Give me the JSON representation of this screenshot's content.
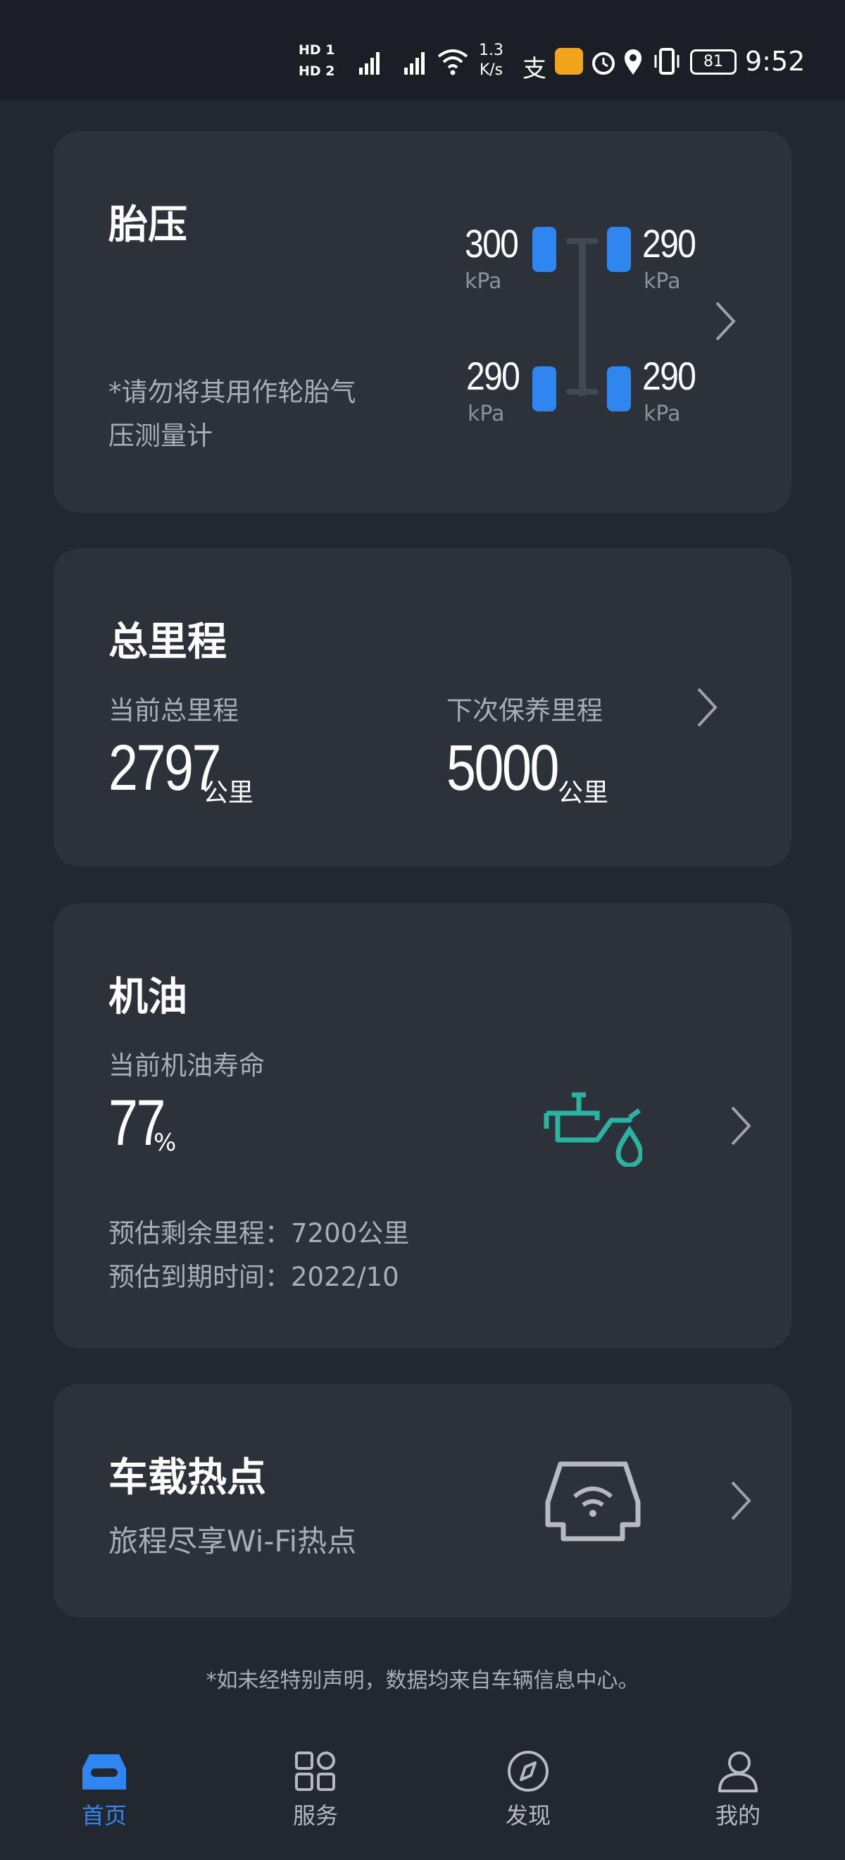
{
  "status_bar": {
    "hd1": "HD 1",
    "hd2": "HD 2",
    "speed_value": "1.3",
    "speed_unit": "K/s",
    "battery": "81",
    "time": "9:52"
  },
  "tire_card": {
    "title": "胎压",
    "note": "*请勿将其用作轮胎气压测量计",
    "unit": "kPa",
    "front_left": "300",
    "front_right": "290",
    "rear_left": "290",
    "rear_right": "290"
  },
  "mileage_card": {
    "title": "总里程",
    "current_label": "当前总里程",
    "current_value": "2797",
    "next_label": "下次保养里程",
    "next_value": "5000",
    "unit": "公里"
  },
  "oil_card": {
    "title": "机油",
    "life_label": "当前机油寿命",
    "life_value": "77",
    "life_unit": "%",
    "remaining_line": "预估剩余里程：7200公里",
    "due_line": "预估到期时间：2022/10"
  },
  "hotspot_card": {
    "title": "车载热点",
    "subtitle": "旅程尽享Wi-Fi热点"
  },
  "footnote": "*如未经特别声明，数据均来自车辆信息中心。",
  "tabs": [
    {
      "label": "首页",
      "icon": "car-icon",
      "active": true
    },
    {
      "label": "服务",
      "icon": "grid-icon",
      "active": false
    },
    {
      "label": "发现",
      "icon": "compass-icon",
      "active": false
    },
    {
      "label": "我的",
      "icon": "person-icon",
      "active": false
    }
  ],
  "colors": {
    "accent": "#2f86f0",
    "oil_icon": "#2ab3a3",
    "background": "#232830",
    "card": "#2c313a"
  }
}
